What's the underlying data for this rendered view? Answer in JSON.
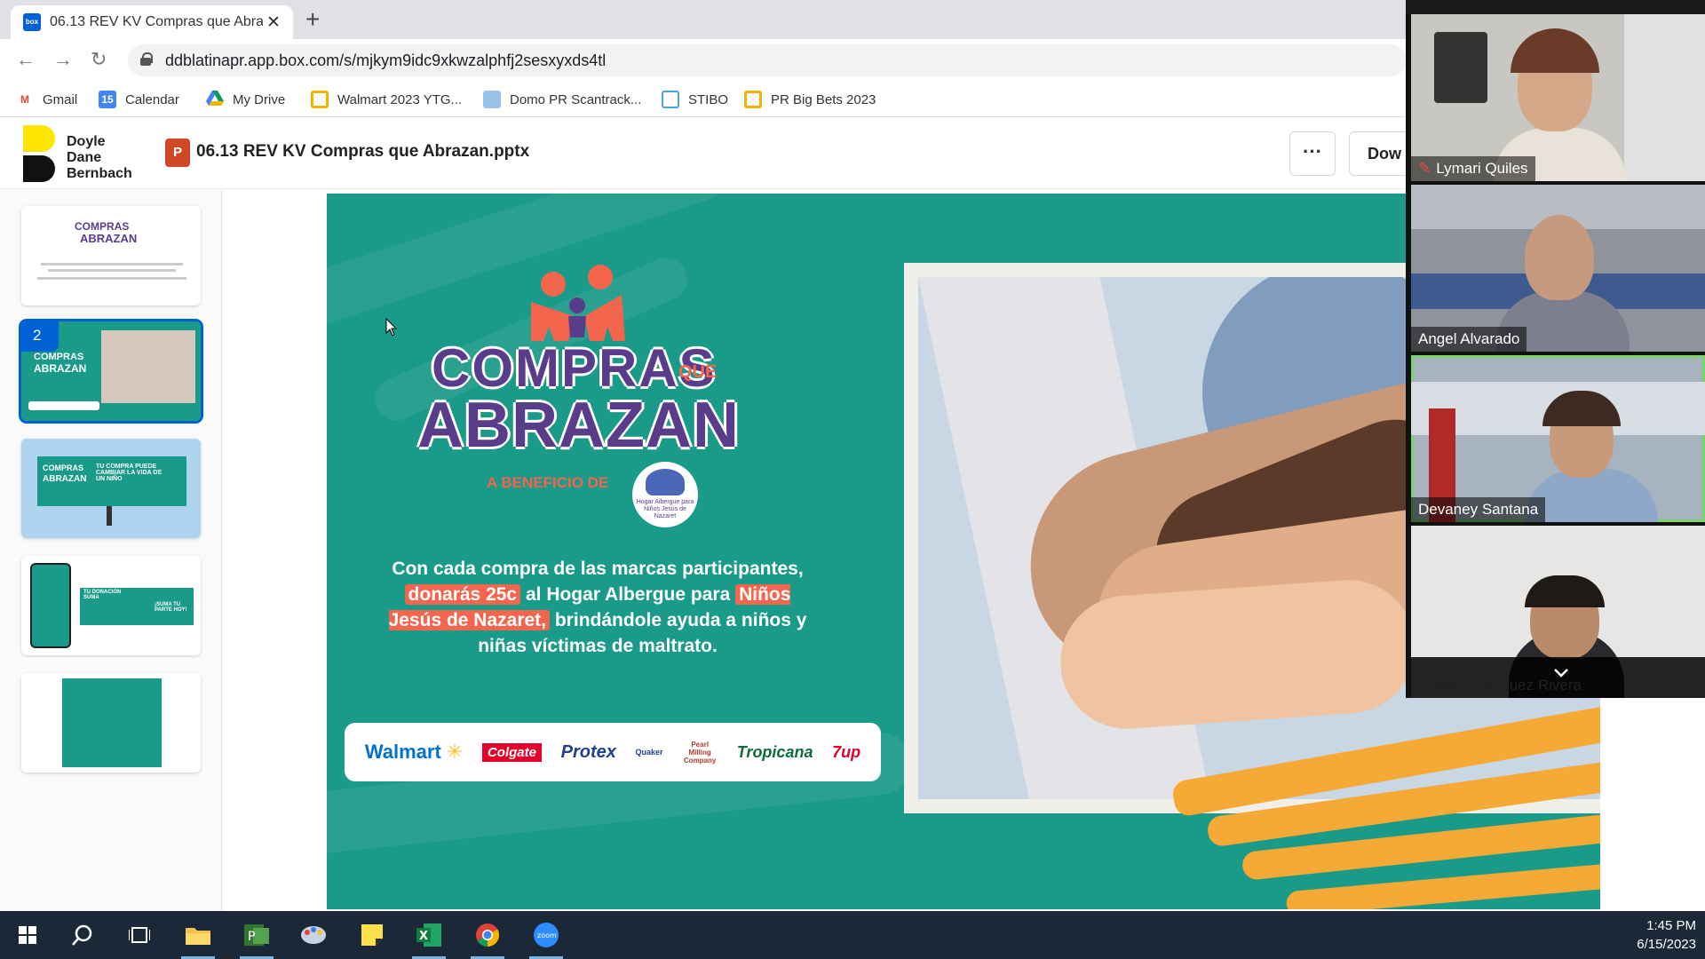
{
  "browser": {
    "tab_title": "06.13 REV KV Compras que Abrazan.pptx",
    "tab_favicon": "box",
    "url": "ddblatinapr.app.box.com/s/mjkym9idc9xkwzalphfj2sesxyxds4tl",
    "bookmarks": [
      {
        "label": "Gmail",
        "icon": "gmail-icon",
        "color": "#ea4335"
      },
      {
        "label": "Calendar",
        "icon": "calendar-icon",
        "color": "#4285f4"
      },
      {
        "label": "My Drive",
        "icon": "drive-icon",
        "color": "#0f9d58"
      },
      {
        "label": "Walmart 2023 YTG...",
        "icon": "slides-icon",
        "color": "#f4b400"
      },
      {
        "label": "Domo PR Scantrack...",
        "icon": "domo-icon",
        "color": "#99c2e6"
      },
      {
        "label": "STIBO",
        "icon": "page-icon",
        "color": "#4aa3df"
      },
      {
        "label": "PR Big Bets 2023",
        "icon": "slides-icon",
        "color": "#f4b400"
      }
    ]
  },
  "box": {
    "brand_lines": [
      "Doyle",
      "Dane",
      "Bernbach"
    ],
    "file_icon_letter": "P",
    "filename": "06.13 REV KV Compras que Abrazan.pptx",
    "more_label": "···",
    "download_label": "Dow"
  },
  "thumbnails": [
    {
      "index": 1,
      "title_top": "COMPRAS",
      "title_bottom": "ABRAZAN"
    },
    {
      "index": 2,
      "label": "2",
      "title_top": "COMPRAS",
      "title_bottom": "ABRAZAN"
    },
    {
      "index": 3,
      "title_top": "COMPRAS",
      "title_bottom": "ABRAZAN",
      "tagline": "TU COMPRA PUEDE CAMBIAR LA VIDA DE UN NIÑO"
    },
    {
      "index": 4,
      "tagline": "TU DONACIÓN SUMA",
      "tagline2": "¡SUMA TU PARTE HOY!"
    },
    {
      "index": 5
    }
  ],
  "slide": {
    "logo_top": "COMPRAS",
    "logo_que": "QUE",
    "logo_bottom": "ABRAZAN",
    "beneficio": "A BENEFICIO DE",
    "hogar": "Hogar Albergue para Niños Jesús de Nazaret",
    "body_1": "Con cada compra de las marcas participantes,",
    "body_hl1": "donarás 25c",
    "body_2": "al Hogar Albergue para",
    "body_hl2": "Niños Jesús de Nazaret,",
    "body_3": "brindándole ayuda a niños y niñas víctimas de maltrato.",
    "brands": [
      "Walmart",
      "Colgate",
      "Protex",
      "Quaker",
      "Pearl Milling Company",
      "Tropicana",
      "7up"
    ]
  },
  "zoom": {
    "participants": [
      {
        "name": "Lymari Quiles",
        "muted": true
      },
      {
        "name": "Angel Alvarado",
        "muted": false
      },
      {
        "name": "Devaney Santana",
        "muted": false,
        "active": true
      },
      {
        "name": "Roberto Vazquez Rivera",
        "muted": true
      }
    ]
  },
  "taskbar": {
    "time": "1:45 PM",
    "date": "6/15/2023",
    "apps": [
      "start-icon",
      "search-icon",
      "task-view-icon",
      "file-explorer-icon",
      "project-icon",
      "paint-icon",
      "sticky-notes-icon",
      "excel-icon",
      "chrome-icon",
      "zoom-icon"
    ]
  }
}
